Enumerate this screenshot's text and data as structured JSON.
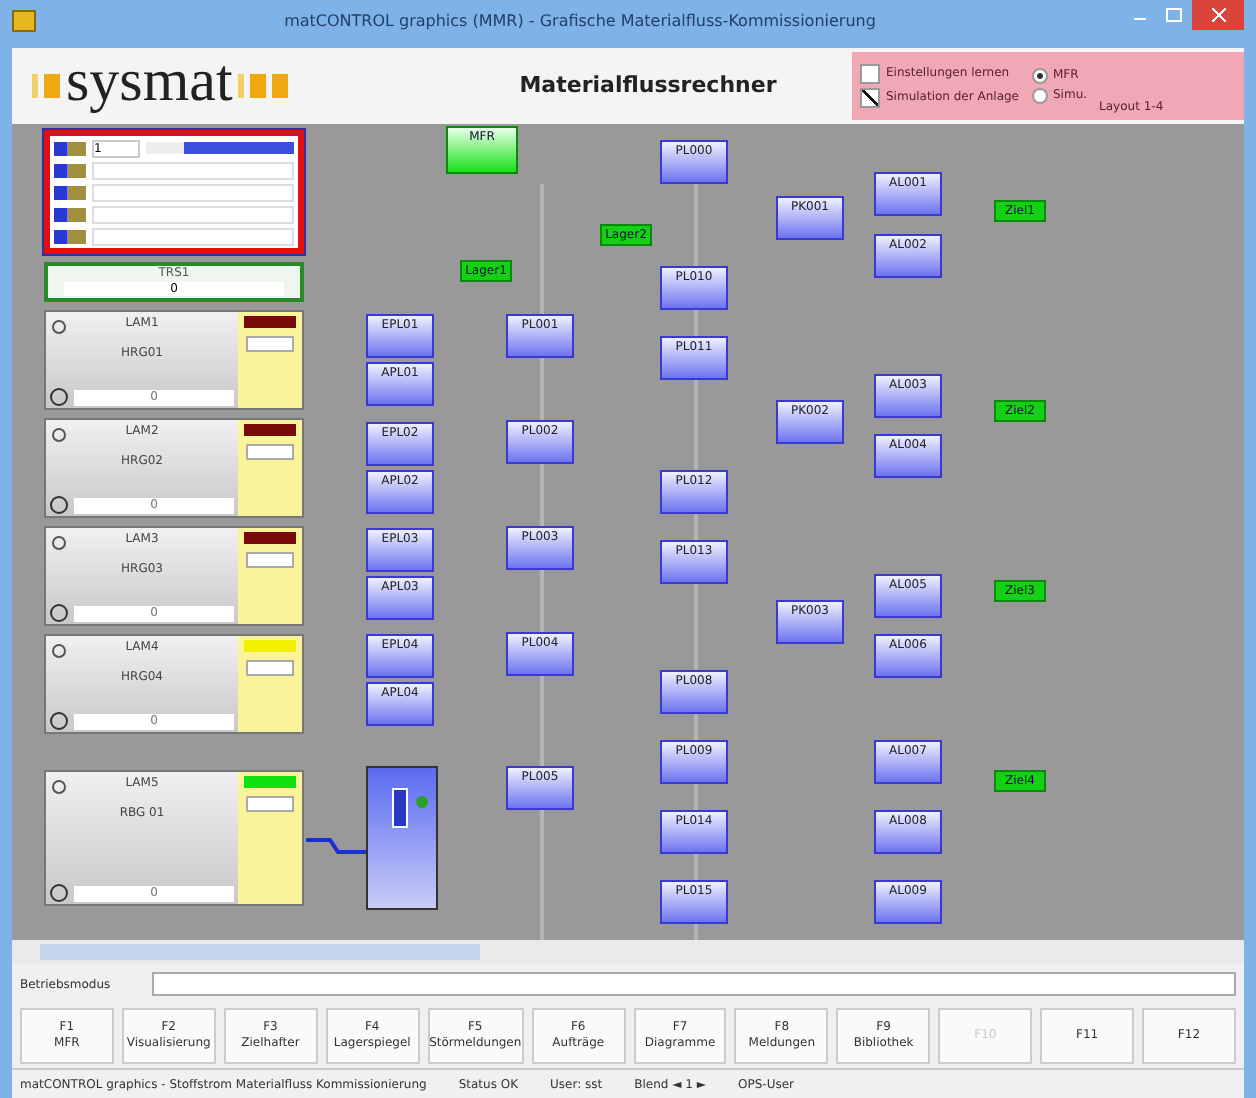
{
  "window": {
    "title": "matCONTROL graphics (MMR) - Grafische Materialfluss-Kommissionierung"
  },
  "header": {
    "logo": "sysmat",
    "title": "Materialflussrechner",
    "checks": [
      {
        "label": "Einstellungen lernen",
        "checked": false
      },
      {
        "label": "Simulation der Anlage",
        "checked": true
      }
    ],
    "modes": [
      {
        "label": "MFR",
        "selected": true
      },
      {
        "label": "Simu.",
        "selected": false
      }
    ],
    "layout": "Layout 1-4"
  },
  "control_box": {
    "value": "1",
    "level": 0.75
  },
  "transfer": {
    "title": "TRS1",
    "value": "0"
  },
  "devices": [
    {
      "title": "LAM1",
      "name": "HRG01",
      "color": "#7a0a0a",
      "footer": "0"
    },
    {
      "title": "LAM2",
      "name": "HRG02",
      "color": "#7a0a0a",
      "footer": "0"
    },
    {
      "title": "LAM3",
      "name": "HRG03",
      "color": "#7a0a0a",
      "footer": "0"
    },
    {
      "title": "LAM4",
      "name": "HRG04",
      "color": "#f0f000",
      "footer": "0"
    },
    {
      "title": "LAM5",
      "name": "RBG 01",
      "color": "#10e010",
      "footer": "0"
    }
  ],
  "diagram": {
    "columns": [
      [
        "EPL01",
        "APL01",
        "EPL02",
        "APL02",
        "EPL03",
        "APL03",
        "EPL04",
        "APL04"
      ],
      [
        "PL001",
        "PL002",
        "PL003",
        "PL004",
        "PL005"
      ],
      [
        "PL000",
        "PL010",
        "PL011",
        "PL012",
        "PL013",
        "PL008",
        "PL009",
        "PL014",
        "PL015"
      ],
      [
        "PK001",
        "PK002",
        "PK003"
      ],
      [
        "AL001",
        "AL002",
        "AL003",
        "AL004",
        "AL005",
        "AL006",
        "AL007",
        "AL008",
        "AL009"
      ]
    ],
    "markers": [
      "MFR",
      "Lager1",
      "Lager2",
      "Ziel1",
      "Ziel2",
      "Ziel3",
      "Ziel4"
    ]
  },
  "command": {
    "label": "Betriebsmodus"
  },
  "function_keys": [
    {
      "key": "F1",
      "label": "MFR",
      "disabled": false
    },
    {
      "key": "F2",
      "label": "Visualisierung",
      "disabled": false
    },
    {
      "key": "F3",
      "label": "Zielhafter",
      "disabled": false
    },
    {
      "key": "F4",
      "label": "Lagerspiegel",
      "disabled": false
    },
    {
      "key": "F5",
      "label": "Störmeldungen",
      "disabled": false
    },
    {
      "key": "F6",
      "label": "Aufträge",
      "disabled": false
    },
    {
      "key": "F7",
      "label": "Diagramme",
      "disabled": false
    },
    {
      "key": "F8",
      "label": "Meldungen",
      "disabled": false
    },
    {
      "key": "F9",
      "label": "Bibliothek",
      "disabled": false
    },
    {
      "key": "F10",
      "disabled": true
    },
    {
      "key": "F11",
      "disabled": false
    },
    {
      "key": "F12",
      "disabled": false
    }
  ],
  "status_bar": [
    "matCONTROL graphics - Stoffstrom Materialfluss Kommissionierung",
    "Status OK",
    "User: sst",
    "Blend ◄ 1 ►",
    "OPS-User"
  ]
}
